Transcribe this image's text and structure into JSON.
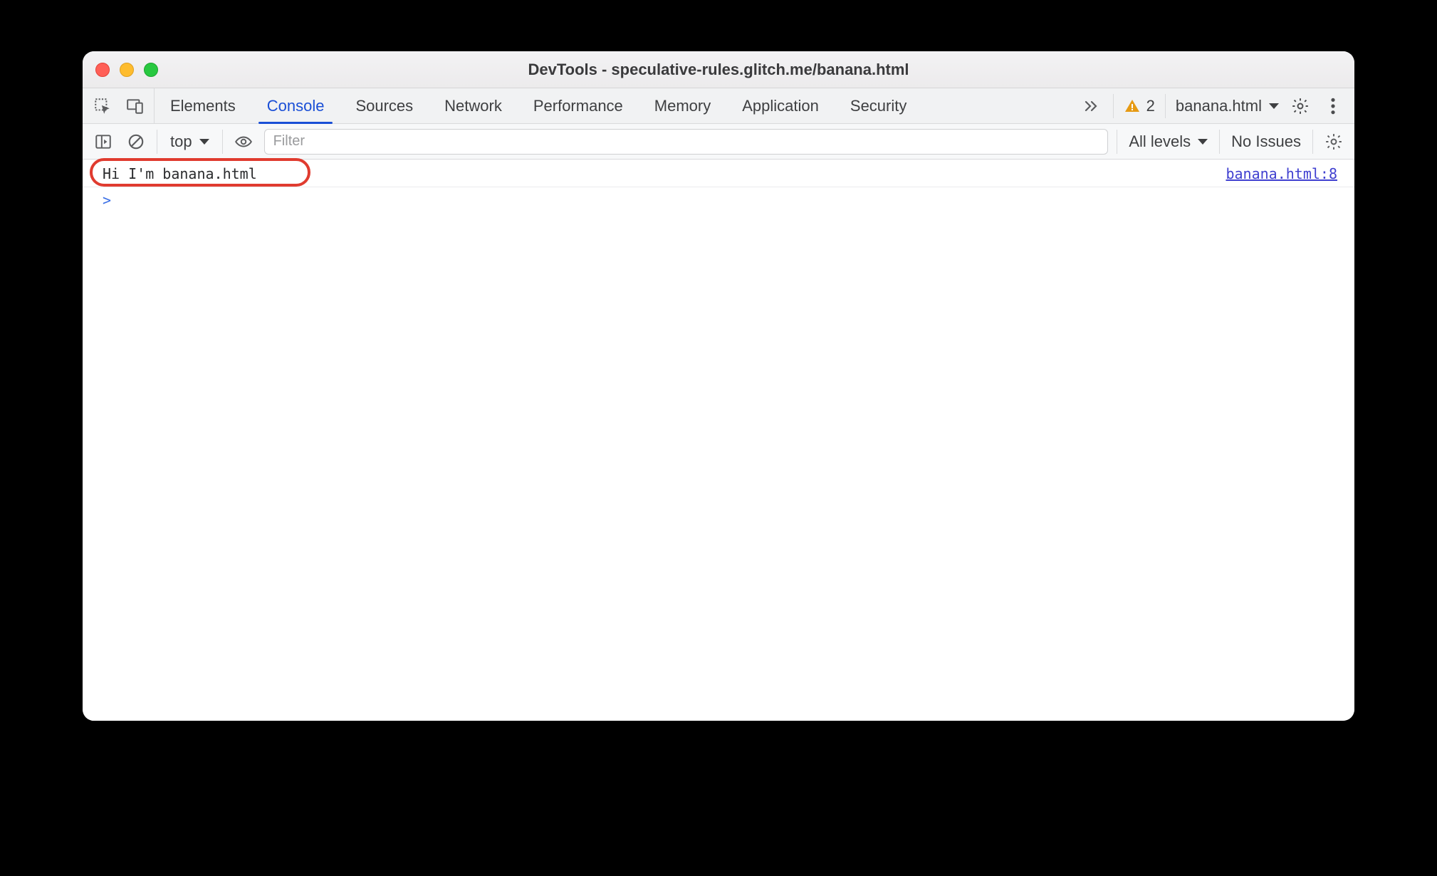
{
  "window": {
    "title": "DevTools - speculative-rules.glitch.me/banana.html"
  },
  "tabs": [
    {
      "label": "Elements"
    },
    {
      "label": "Console"
    },
    {
      "label": "Sources"
    },
    {
      "label": "Network"
    },
    {
      "label": "Performance"
    },
    {
      "label": "Memory"
    },
    {
      "label": "Application"
    },
    {
      "label": "Security"
    }
  ],
  "active_tab_index": 1,
  "tabstrip_right": {
    "warning_count": "2",
    "target_context": "banana.html"
  },
  "console_toolbar": {
    "context": "top",
    "filter_placeholder": "Filter",
    "levels_label": "All levels",
    "issues_label": "No Issues"
  },
  "console": {
    "log_text": "Hi I'm banana.html",
    "source_link": "banana.html:8",
    "prompt": ">"
  },
  "colors": {
    "accent": "#1a4fd6",
    "warn": "#e69a13",
    "ring": "#e03b2f",
    "link": "#4040d0"
  }
}
